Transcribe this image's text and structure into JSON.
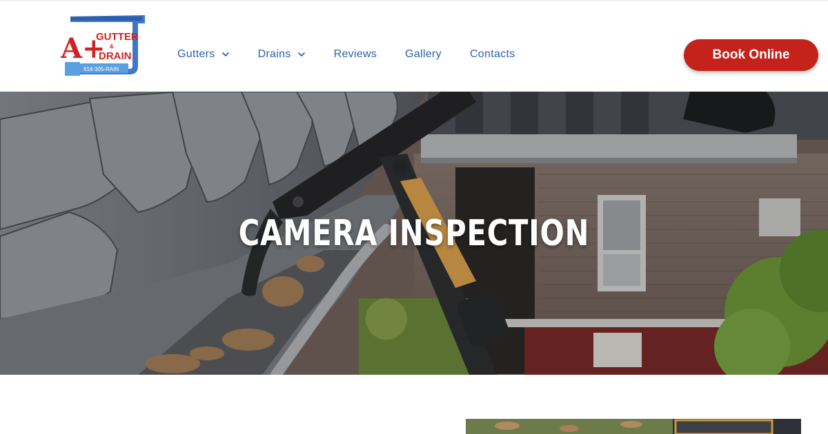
{
  "brand": {
    "logo_text_top": "GUTTER",
    "logo_text_amp": "&",
    "logo_text_bottom": "DRAIN",
    "logo_mark": "A+",
    "phone": "614-305-RAIN",
    "brand_red": "#c4221b",
    "brand_blue": "#2b63a8"
  },
  "nav": {
    "items": [
      {
        "label": "Gutters",
        "has_dropdown": true
      },
      {
        "label": "Drains",
        "has_dropdown": true
      },
      {
        "label": "Reviews",
        "has_dropdown": false
      },
      {
        "label": "Gallery",
        "has_dropdown": false
      },
      {
        "label": "Contacts",
        "has_dropdown": false
      }
    ],
    "cta_label": "Book Online"
  },
  "hero": {
    "title": "CAMERA INSPECTION"
  },
  "icons": [
    "chevron-down-icon"
  ]
}
